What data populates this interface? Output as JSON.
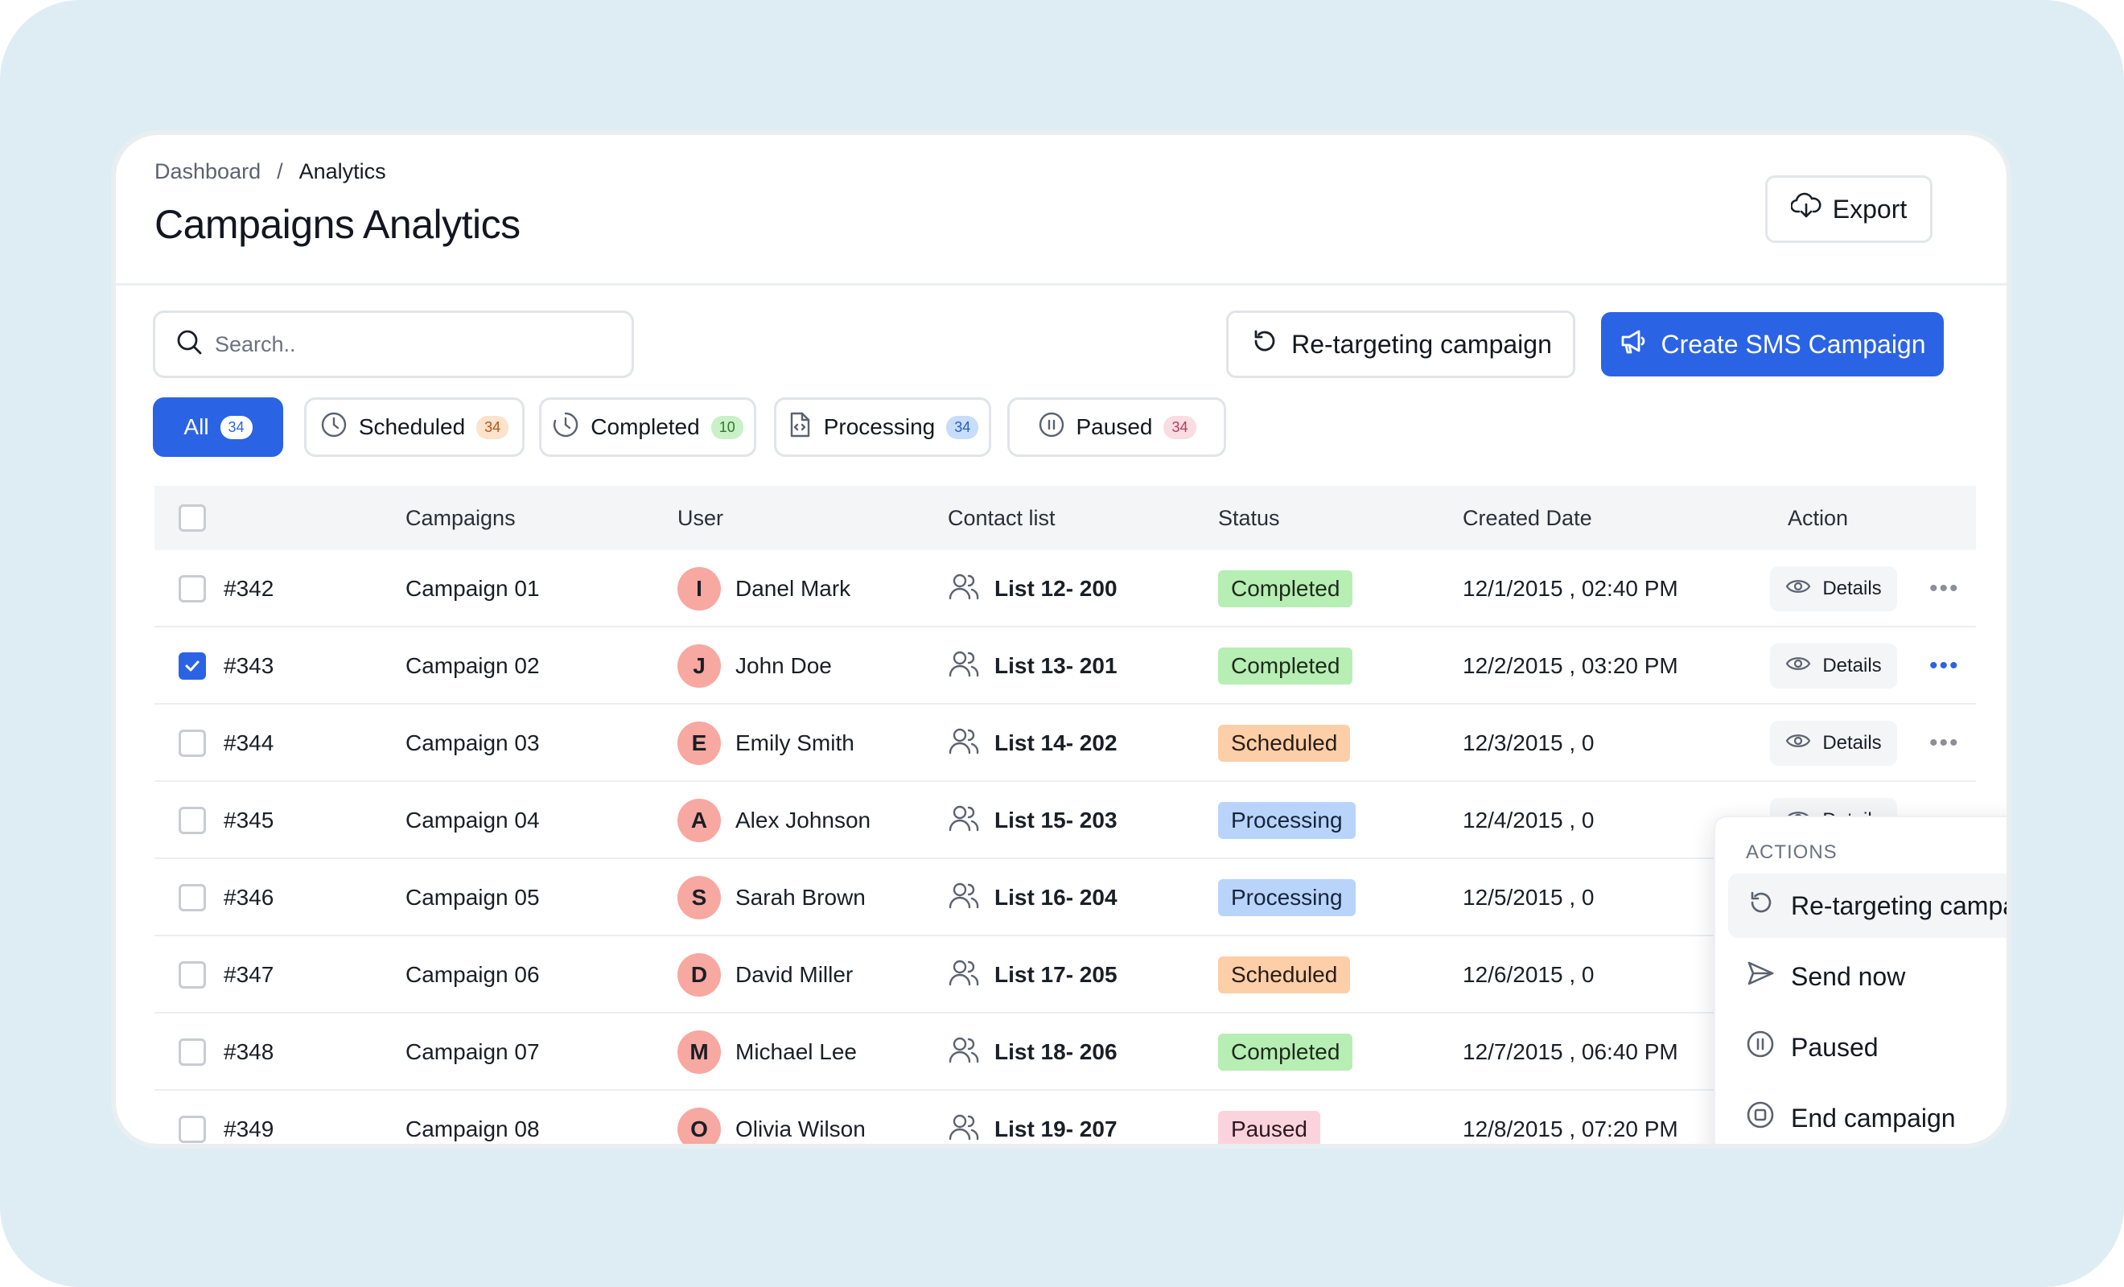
{
  "breadcrumb": {
    "root": "Dashboard",
    "separator": "/",
    "current": "Analytics"
  },
  "page": {
    "title": "Campaigns Analytics"
  },
  "toolbar": {
    "export_label": "Export",
    "search_placeholder": "Search..",
    "retarget_label": "Re-targeting campaign",
    "create_label": "Create SMS Campaign"
  },
  "icons": {
    "export": "cloud-download-icon",
    "search": "search-icon",
    "retarget": "refresh-icon",
    "create": "megaphone-icon",
    "scheduled": "clock-icon",
    "completed": "clock-icon",
    "processing": "file-code-icon",
    "paused": "pause-icon",
    "contact": "users-icon",
    "details": "eye-icon",
    "more": "more-horizontal-icon"
  },
  "filters": [
    {
      "label": "All",
      "count": "34",
      "active": true
    },
    {
      "label": "Scheduled",
      "count": "34",
      "count_bg": "#fde2cc",
      "count_fg": "#b4561b"
    },
    {
      "label": "Completed",
      "count": "10",
      "count_bg": "#c9f0c6",
      "count_fg": "#2f7a2a"
    },
    {
      "label": "Processing",
      "count": "34",
      "count_bg": "#c8ddfb",
      "count_fg": "#245fc0"
    },
    {
      "label": "Paused",
      "count": "34",
      "count_bg": "#fadce3",
      "count_fg": "#b53b5c"
    }
  ],
  "table": {
    "headers": {
      "campaigns": "Campaigns",
      "user": "User",
      "contact": "Contact list",
      "status": "Status",
      "created": "Created Date",
      "action": "Action"
    },
    "details_label": "Details",
    "rows": [
      {
        "id": "#342",
        "campaign": "Campaign 01",
        "initial": "I",
        "user": "Danel Mark",
        "list": "List 12- 200",
        "status": "Completed",
        "date": "12/1/2015 , 02:40 PM",
        "checked": false
      },
      {
        "id": "#343",
        "campaign": "Campaign 02",
        "initial": "J",
        "user": "John Doe",
        "list": "List 13- 201",
        "status": "Completed",
        "date": "12/2/2015 , 03:20 PM",
        "checked": true
      },
      {
        "id": "#344",
        "campaign": "Campaign 03",
        "initial": "E",
        "user": "Emily Smith",
        "list": "List 14- 202",
        "status": "Scheduled",
        "date": "12/3/2015 , 0",
        "checked": false
      },
      {
        "id": "#345",
        "campaign": "Campaign 04",
        "initial": "A",
        "user": "Alex Johnson",
        "list": "List 15- 203",
        "status": "Processing",
        "date": "12/4/2015 , 0",
        "checked": false
      },
      {
        "id": "#346",
        "campaign": "Campaign 05",
        "initial": "S",
        "user": "Sarah Brown",
        "list": "List 16- 204",
        "status": "Processing",
        "date": "12/5/2015 , 0",
        "checked": false
      },
      {
        "id": "#347",
        "campaign": "Campaign 06",
        "initial": "D",
        "user": "David Miller",
        "list": "List 17- 205",
        "status": "Scheduled",
        "date": "12/6/2015 , 0",
        "checked": false
      },
      {
        "id": "#348",
        "campaign": "Campaign 07",
        "initial": "M",
        "user": "Michael Lee",
        "list": "List 18- 206",
        "status": "Completed",
        "date": "12/7/2015 , 06:40 PM",
        "checked": false
      },
      {
        "id": "#349",
        "campaign": "Campaign 08",
        "initial": "O",
        "user": "Olivia Wilson",
        "list": "List 19- 207",
        "status": "Paused",
        "date": "12/8/2015 , 07:20 PM",
        "checked": false
      }
    ]
  },
  "status_colors": {
    "Completed": {
      "bg": "#b7eeb3",
      "fg": "#1d2a1c"
    },
    "Scheduled": {
      "bg": "#fccfa8",
      "fg": "#2a1d14"
    },
    "Processing": {
      "bg": "#b9d4fb",
      "fg": "#16243a"
    },
    "Paused": {
      "bg": "#fbd3dd",
      "fg": "#2e1820"
    }
  },
  "colors": {
    "accent": "#2b63e5",
    "background": "#deedf4"
  },
  "actions_menu": {
    "heading": "ACTIONS",
    "items": [
      {
        "label": "Re-targeting campaign",
        "icon": "refresh-icon"
      },
      {
        "label": "Send now",
        "icon": "send-icon"
      },
      {
        "label": "Paused",
        "icon": "pause-circle-icon"
      },
      {
        "label": "End campaign",
        "icon": "stop-circle-icon"
      }
    ]
  }
}
